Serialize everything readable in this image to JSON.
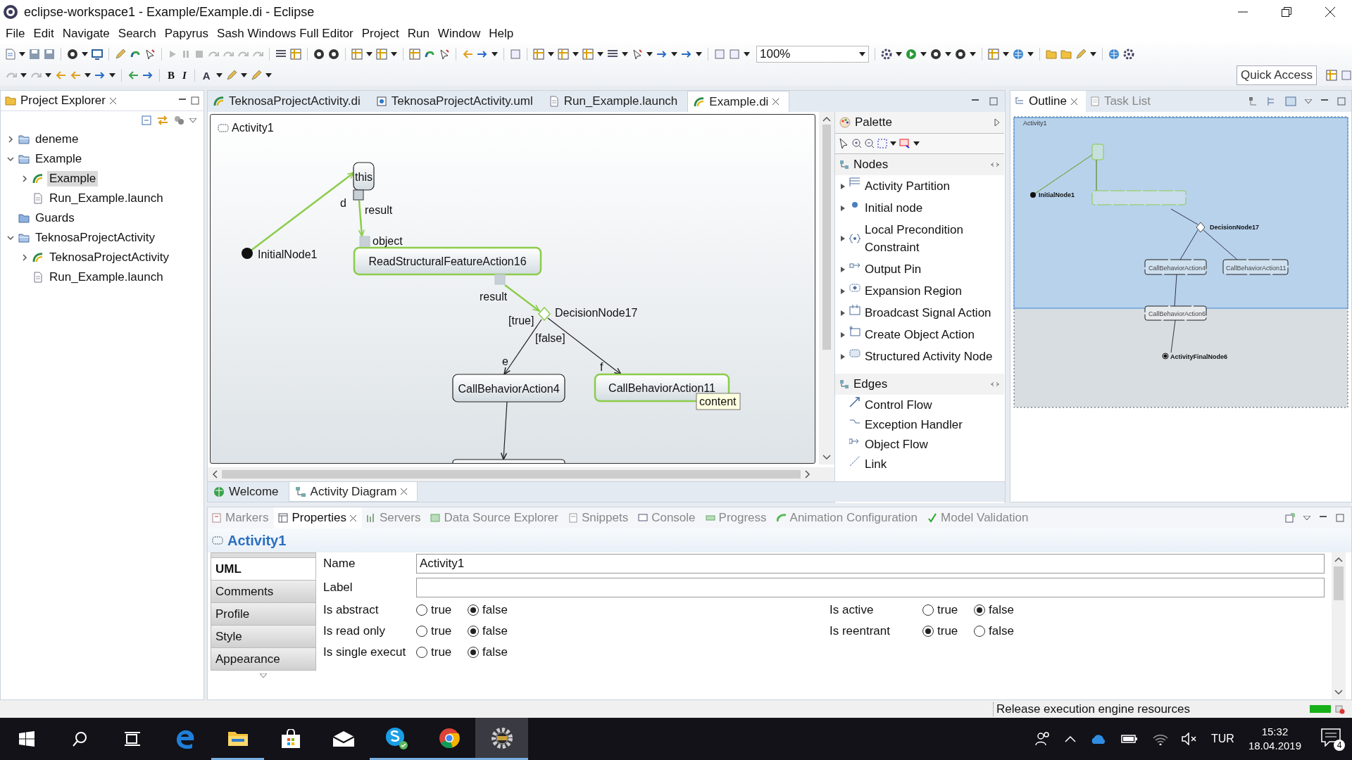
{
  "window": {
    "title": "eclipse-workspace1 - Example/Example.di - Eclipse"
  },
  "menu": [
    "File",
    "Edit",
    "Navigate",
    "Search",
    "Papyrus",
    "Sash Windows Full Editor",
    "Project",
    "Run",
    "Window",
    "Help"
  ],
  "toolbar": {
    "format_buttons": [
      "B",
      "I",
      "A"
    ],
    "zoom": "100%",
    "quick_access": "Quick Access"
  },
  "project_explorer": {
    "title": "Project Explorer",
    "items": [
      {
        "label": "deneme",
        "kind": "project",
        "expanded": false,
        "selected": false
      },
      {
        "label": "Example",
        "kind": "project",
        "expanded": true,
        "selected": false,
        "children": [
          {
            "label": "Example",
            "kind": "model",
            "expanded": false,
            "selected": true
          },
          {
            "label": "Run_Example.launch",
            "kind": "file",
            "selected": false
          }
        ]
      },
      {
        "label": "Guards",
        "kind": "folder",
        "selected": false
      },
      {
        "label": "TeknosaProjectActivity",
        "kind": "project",
        "expanded": true,
        "selected": false,
        "children": [
          {
            "label": "TeknosaProjectActivity",
            "kind": "model",
            "expanded": false,
            "selected": false
          },
          {
            "label": "Run_Example.launch",
            "kind": "file",
            "selected": false
          }
        ]
      }
    ]
  },
  "editor": {
    "tabs": [
      {
        "label": "TeknosaProjectActivity.di",
        "kind": "di",
        "selected": false
      },
      {
        "label": "TeknosaProjectActivity.uml",
        "kind": "uml",
        "selected": false
      },
      {
        "label": "Run_Example.launch",
        "kind": "launch",
        "selected": false
      },
      {
        "label": "Example.di",
        "kind": "di",
        "selected": true
      }
    ],
    "diagram": {
      "title": "Activity1",
      "nodes": [
        {
          "kind": "initial",
          "label": "InitialNode1"
        },
        {
          "kind": "action",
          "label": "this",
          "highlighted": false
        },
        {
          "kind": "action",
          "label": "ReadStructuralFeatureAction16",
          "highlighted": true
        },
        {
          "kind": "decision",
          "label": "DecisionNode17"
        },
        {
          "kind": "action",
          "label": "CallBehaviorAction4",
          "highlighted": false
        },
        {
          "kind": "action",
          "label": "CallBehaviorAction11",
          "highlighted": true
        },
        {
          "kind": "action",
          "highlighted": false
        }
      ],
      "pins": [
        {
          "label": "result"
        },
        {
          "label": "object"
        },
        {
          "label": "result"
        }
      ],
      "edges": [
        {
          "name": "d",
          "highlighted": true
        },
        {
          "highlighted": true
        },
        {
          "highlighted": true
        },
        {
          "guard": "[true]",
          "name": "e",
          "highlighted": false
        },
        {
          "guard": "[false]",
          "name": "f",
          "highlighted": false
        },
        {
          "highlighted": false
        }
      ],
      "tooltip": "content"
    },
    "palette": {
      "title": "Palette",
      "drawers": [
        {
          "label": "Nodes",
          "items": [
            "Activity Partition",
            "Initial node",
            "Local Precondition Constraint",
            "Output Pin",
            "Expansion Region",
            "Broadcast Signal Action",
            "Create Object Action",
            "Structured Activity Node"
          ]
        },
        {
          "label": "Edges",
          "items": [
            "Control Flow",
            "Exception Handler",
            "Object Flow",
            "Link"
          ]
        }
      ]
    },
    "bottom_tabs": [
      {
        "label": "Welcome",
        "selected": false
      },
      {
        "label": "Activity Diagram",
        "selected": true
      }
    ]
  },
  "outline": {
    "tabs": [
      {
        "label": "Outline",
        "selected": true
      },
      {
        "label": "Task List",
        "selected": false
      }
    ],
    "labels": [
      "Activity1",
      "InitialNode1",
      "DecisionNode17",
      "CallBehaviorAction4",
      "CallBehaviorAction11",
      "CallBehaviorAction6",
      "ActivityFinalNode6"
    ]
  },
  "properties": {
    "tabs": [
      {
        "label": "Markers",
        "selected": false
      },
      {
        "label": "Properties",
        "selected": true
      },
      {
        "label": "Servers",
        "selected": false
      },
      {
        "label": "Data Source Explorer",
        "selected": false
      },
      {
        "label": "Snippets",
        "selected": false
      },
      {
        "label": "Console",
        "selected": false
      },
      {
        "label": "Progress",
        "selected": false
      },
      {
        "label": "Animation Configuration",
        "selected": false
      },
      {
        "label": "Model Validation",
        "selected": false
      }
    ],
    "title": "Activity1",
    "side_tabs": [
      {
        "label": "UML",
        "selected": true
      },
      {
        "label": "Comments",
        "selected": false
      },
      {
        "label": "Profile",
        "selected": false
      },
      {
        "label": "Style",
        "selected": false
      },
      {
        "label": "Appearance",
        "selected": false
      }
    ],
    "fields": [
      {
        "label": "Name",
        "value": "Activity1"
      },
      {
        "label": "Label"
      }
    ],
    "booleans": [
      {
        "label": "Is abstract",
        "options": [
          {
            "label": "true",
            "selected": false
          },
          {
            "label": "false",
            "selected": true
          }
        ]
      },
      {
        "label": "Is active",
        "options": [
          {
            "label": "true",
            "selected": false
          },
          {
            "label": "false",
            "selected": true
          }
        ]
      },
      {
        "label": "Is read only",
        "options": [
          {
            "label": "true",
            "selected": false
          },
          {
            "label": "false",
            "selected": true
          }
        ]
      },
      {
        "label": "Is reentrant",
        "options": [
          {
            "label": "true",
            "selected": true
          },
          {
            "label": "false",
            "selected": false
          }
        ]
      },
      {
        "label": "Is single execut",
        "options": [
          {
            "label": "true",
            "selected": false
          },
          {
            "label": "false",
            "selected": true
          }
        ]
      }
    ]
  },
  "status_bar": {
    "message": "Release execution engine resources",
    "progress": {
      "level": 1
    }
  },
  "taskbar": {
    "language": "TUR",
    "time": "15:32",
    "date": "18.04.2019",
    "notifications": "4"
  }
}
